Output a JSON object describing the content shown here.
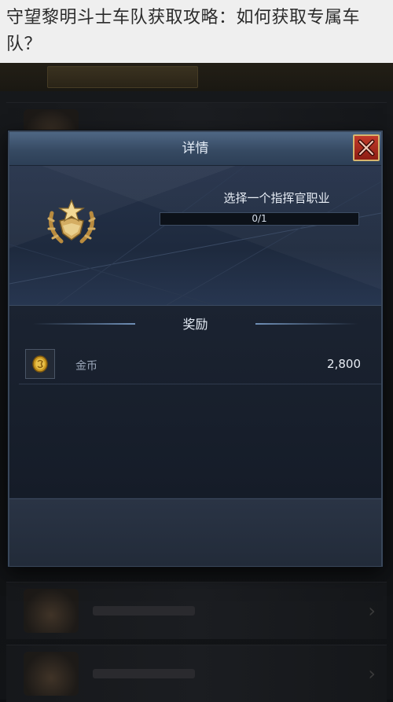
{
  "article": {
    "title": "守望黎明斗士车队获取攻略：如何获取专属车队？"
  },
  "dialog": {
    "title": "详情",
    "close_icon": "close-icon",
    "task": {
      "label": "选择一个指挥官职业",
      "progress_text": "0/1",
      "progress_fraction": 0
    },
    "rewards": {
      "heading": "奖励",
      "items": [
        {
          "icon": "gold-coin-icon",
          "name": "金币",
          "amount": "2,800"
        }
      ]
    }
  },
  "colors": {
    "header": "#4f6784",
    "close_button": "#c23a2a",
    "close_border": "#d6b56e",
    "badge_gold": "#d4ad62"
  }
}
